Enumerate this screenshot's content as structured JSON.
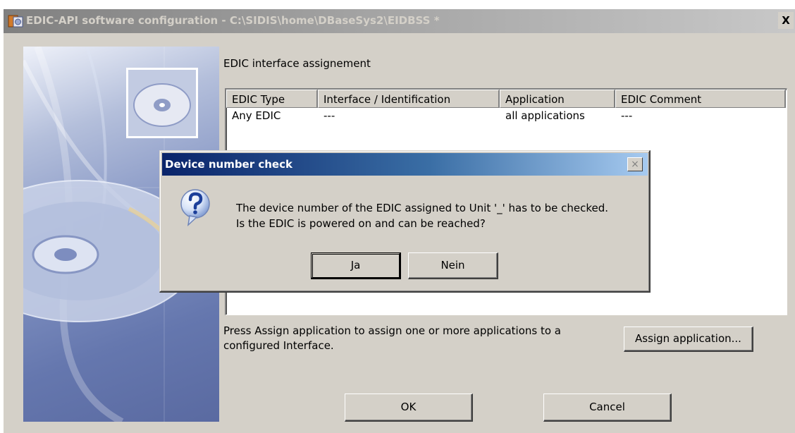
{
  "window": {
    "title": "EDIC-API software configuration - C:\\SIDIS\\home\\DBaseSys2\\EIDBSS *",
    "close_label": "X"
  },
  "main": {
    "section_label": "EDIC interface assignement",
    "table": {
      "columns": [
        "EDIC Type",
        "Interface / Identification",
        "Application",
        "EDIC Comment"
      ],
      "rows": [
        [
          "Any EDIC",
          "---",
          "all applications",
          "---"
        ]
      ]
    },
    "hint": "Press Assign application to assign one or more applications to a configured Interface.",
    "assign_button": "Assign application...",
    "ok_button": "OK",
    "cancel_button": "Cancel"
  },
  "dialog": {
    "title": "Device number check",
    "close_label": "×",
    "icon": "question-icon",
    "message_line1": "The device number of the EDIC assigned to Unit '_' has to be checked.",
    "message_line2": "Is the EDIC is powered on and can be reached?",
    "yes_button": "Ja",
    "no_button": "Nein"
  },
  "colors": {
    "face": "#d4d0c8",
    "active_title": "#0a246a",
    "inactive_title": "#808080"
  }
}
